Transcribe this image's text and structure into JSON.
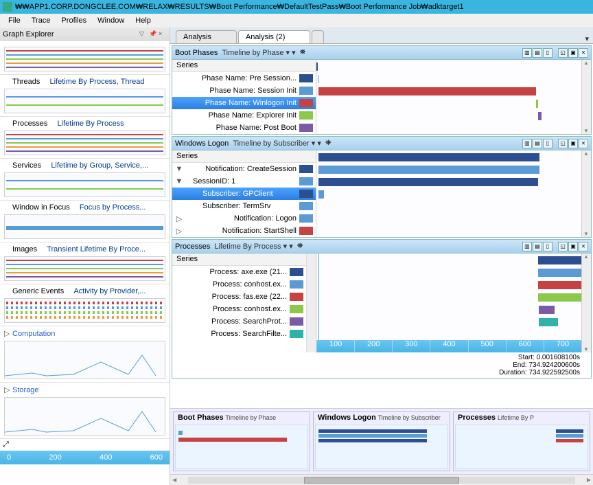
{
  "window": {
    "title": "₩₩APP1.CORP.DONGCLEE.COM₩RELAX₩RESULTS₩Boot Performance₩DefaultTestPass₩Boot Performance Job₩adktarget1"
  },
  "menu": [
    "File",
    "Trace",
    "Profiles",
    "Window",
    "Help"
  ],
  "sidebar": {
    "title": "Graph Explorer",
    "items": [
      {
        "name": "",
        "mode": "",
        "type": "bars"
      },
      {
        "name": "Threads",
        "mode": "Lifetime By Process, Thread",
        "type": "sparse"
      },
      {
        "name": "Processes",
        "mode": "Lifetime By Process",
        "type": "bars"
      },
      {
        "name": "Services",
        "mode": "Lifetime by Group, Service,...",
        "type": "sparse"
      },
      {
        "name": "Window in Focus",
        "mode": "Focus by Process...",
        "type": "blue"
      },
      {
        "name": "Images",
        "mode": "Transient Lifetime By Proce...",
        "type": "bars"
      },
      {
        "name": "Generic Events",
        "mode": "Activity by Provider,...",
        "type": "dots"
      }
    ],
    "categories": [
      {
        "name": "Computation"
      },
      {
        "name": "Storage"
      }
    ],
    "ruler": [
      "0",
      "200",
      "400",
      "600"
    ]
  },
  "tabs": [
    {
      "label": "Analysis",
      "active": false
    },
    {
      "label": "Analysis (2)",
      "active": true
    }
  ],
  "panels": [
    {
      "title": "Boot Phases",
      "mode": "Timeline by Phase",
      "series_label": "Series",
      "rows": [
        {
          "txt": "Phase Name: Pre Session...",
          "color": "#2d4f8f",
          "sel": false
        },
        {
          "txt": "Phase Name: Session Init",
          "color": "#5b9bd5",
          "sel": false
        },
        {
          "txt": "Phase Name: Winlogon Init",
          "color": "#c74343",
          "sel": true
        },
        {
          "txt": "Phase Name: Explorer Init",
          "color": "#8cc84b",
          "sel": false
        },
        {
          "txt": "Phase Name: Post Boot",
          "color": "#7b5aa6",
          "sel": false
        }
      ],
      "chart_data": {
        "type": "bar",
        "xlim": [
          0,
          750
        ],
        "bars": [
          {
            "row": 0,
            "start": 0,
            "end": 3,
            "color": "#2d4f8f"
          },
          {
            "row": 1,
            "start": 3,
            "end": 6,
            "color": "#5b9bd5"
          },
          {
            "row": 2,
            "start": 6,
            "end": 600,
            "color": "#c74343"
          },
          {
            "row": 3,
            "start": 600,
            "end": 605,
            "color": "#8cc84b"
          },
          {
            "row": 4,
            "start": 605,
            "end": 615,
            "color": "#7b5aa6"
          }
        ]
      }
    },
    {
      "title": "Windows Logon",
      "mode": "Timeline by Subscriber",
      "series_label": "Series",
      "rows": [
        {
          "txt": "Notification: CreateSession",
          "color": "#2d4f8f",
          "caret": "▼",
          "indent": 0
        },
        {
          "txt": "SessionID: 1",
          "color": "#5b9bd5",
          "caret": "▼",
          "indent": 1
        },
        {
          "txt": "Subscriber: GPClient",
          "color": "#2d4f8f",
          "sel": true,
          "indent": 2
        },
        {
          "txt": "Subscriber: TermSrv",
          "color": "#5b9bd5",
          "indent": 2
        },
        {
          "txt": "Notification: Logon",
          "color": "#5b9bd5",
          "caret": "▷",
          "indent": 0
        },
        {
          "txt": "Notification: StartShell",
          "color": "#c74343",
          "caret": "▷",
          "indent": 0
        }
      ],
      "chart_data": {
        "type": "bar",
        "xlim": [
          0,
          750
        ],
        "bars": [
          {
            "row": 0,
            "start": 5,
            "end": 610,
            "color": "#2d4f8f"
          },
          {
            "row": 1,
            "start": 5,
            "end": 610,
            "color": "#5b9bd5"
          },
          {
            "row": 2,
            "start": 5,
            "end": 605,
            "color": "#2d4f8f"
          },
          {
            "row": 3,
            "start": 5,
            "end": 20,
            "color": "#5b9bd5"
          }
        ]
      }
    },
    {
      "title": "Processes",
      "mode": "Lifetime By Process",
      "series_label": "Series",
      "rows": [
        {
          "txt": "Process: axe.exe (21...",
          "color": "#2d4f8f"
        },
        {
          "txt": "Process: conhost.ex...",
          "color": "#5b9bd5"
        },
        {
          "txt": "Process: fas.exe (22...",
          "color": "#c74343"
        },
        {
          "txt": "Process: conhost.ex...",
          "color": "#8cc84b"
        },
        {
          "txt": "Process: SearchProt...",
          "color": "#7b5aa6"
        },
        {
          "txt": "Process: SearchFilte...",
          "color": "#2fb3a8"
        }
      ],
      "has_series_scroll": true,
      "stats": {
        "start_label": "Start:",
        "start": "0.001608100s",
        "end_label": "End:",
        "end": "734.924200600s",
        "dur_label": "Duration:",
        "dur": "734.922592500s"
      },
      "chart_data": {
        "type": "bar",
        "xlim": [
          0,
          750
        ],
        "ticks": [
          "100",
          "200",
          "300",
          "400",
          "500",
          "600",
          "700"
        ],
        "bars": [
          {
            "row": 0,
            "start": 605,
            "end": 740,
            "color": "#2d4f8f"
          },
          {
            "row": 1,
            "start": 605,
            "end": 740,
            "color": "#5b9bd5"
          },
          {
            "row": 2,
            "start": 606,
            "end": 740,
            "color": "#c74343"
          },
          {
            "row": 3,
            "start": 606,
            "end": 740,
            "color": "#8cc84b"
          },
          {
            "row": 4,
            "start": 608,
            "end": 650,
            "color": "#7b5aa6"
          },
          {
            "row": 5,
            "start": 608,
            "end": 660,
            "color": "#2fb3a8"
          }
        ],
        "vline": 5
      }
    }
  ],
  "bottom": [
    {
      "title": "Boot Phases",
      "sub": "Timeline by Phase"
    },
    {
      "title": "Windows Logon",
      "sub": "Timeline by Subscriber"
    },
    {
      "title": "Processes",
      "sub": "Lifetime By P"
    }
  ]
}
